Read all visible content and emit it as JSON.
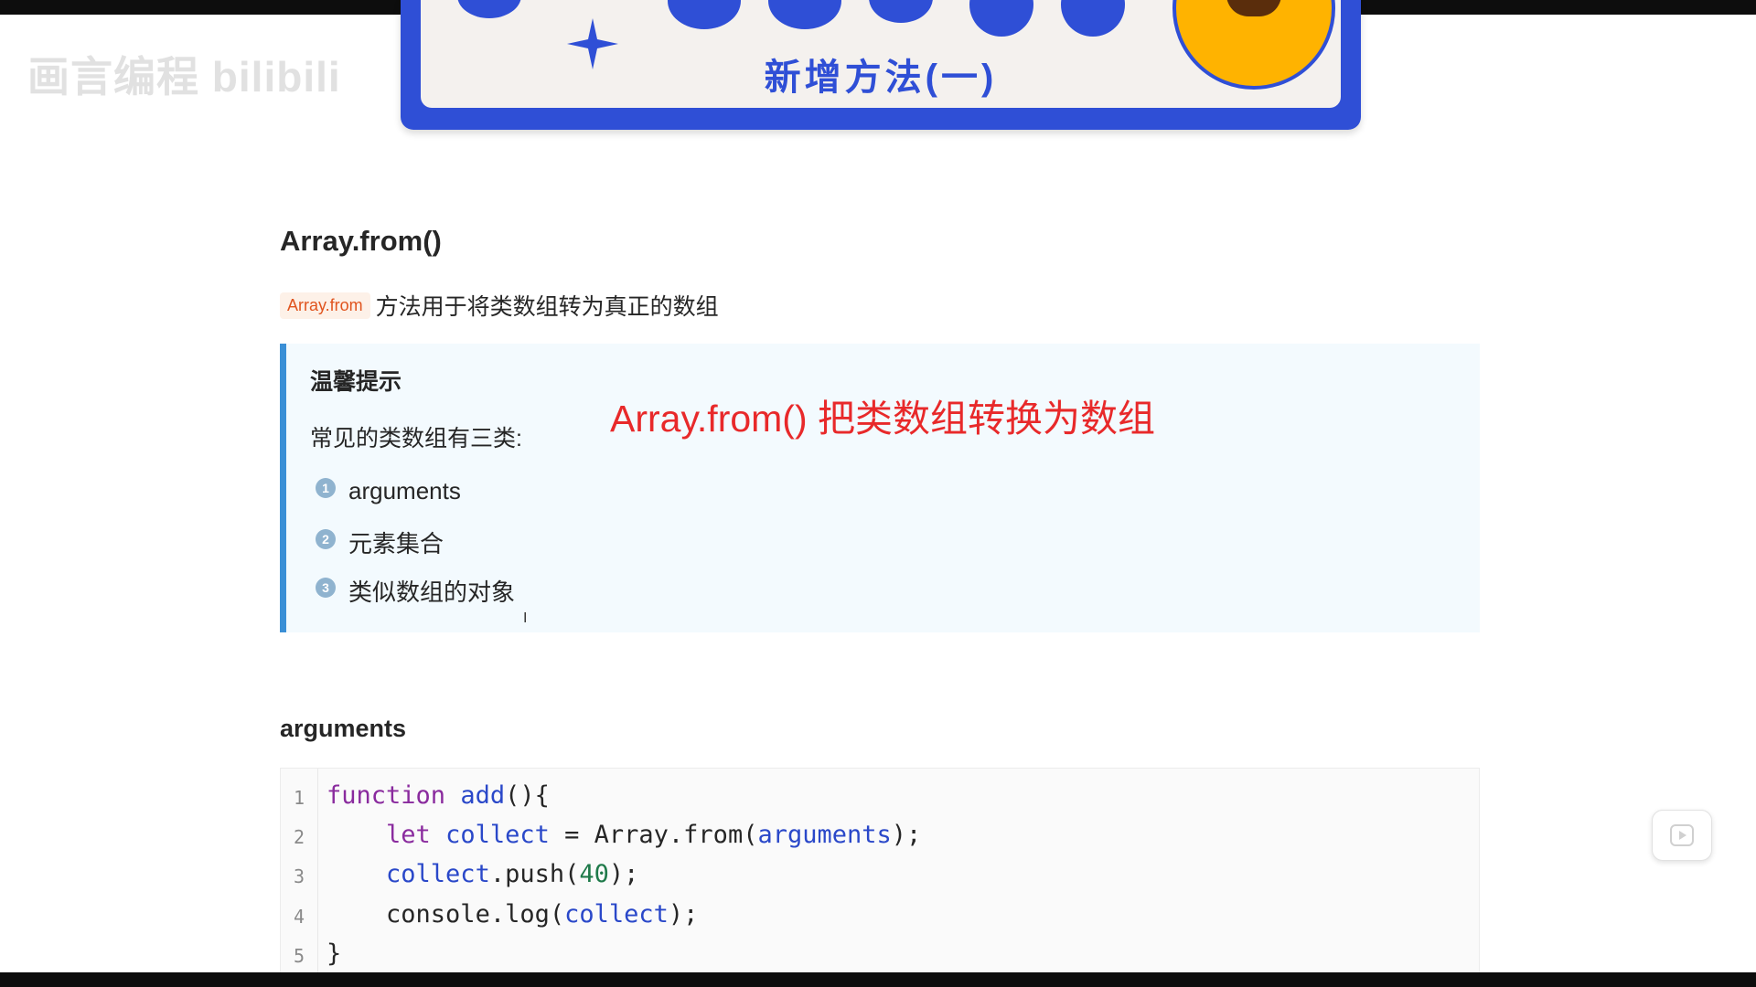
{
  "watermark": {
    "text": "画言编程 bilibili"
  },
  "banner": {
    "title": "新增方法(一)"
  },
  "section1": {
    "heading": "Array.from()",
    "intro_code": "Array.from",
    "intro_text": "方法用于将类数组转为真正的数组"
  },
  "tip": {
    "title": "温馨提示",
    "subtitle": "常见的类数组有三类:",
    "items": [
      {
        "num": "1",
        "label": "arguments"
      },
      {
        "num": "2",
        "label": "元素集合"
      },
      {
        "num": "3",
        "label": "类似数组的对象"
      }
    ]
  },
  "overlay": {
    "caption": "Array.from() 把类数组转换为数组"
  },
  "section2": {
    "heading": "arguments"
  },
  "code": {
    "line_numbers": [
      "1",
      "2",
      "3",
      "4",
      "5"
    ],
    "lines": {
      "l1": {
        "kw": "function",
        "fn": "add",
        "rest": "(){"
      },
      "l2": {
        "kw": "let",
        "var": "collect",
        "mid": " = Array.from(",
        "arg": "arguments",
        "end": ");"
      },
      "l3": {
        "var": "collect",
        "mid": ".push(",
        "num": "40",
        "end": ");"
      },
      "l4": {
        "mid": "console.log(",
        "var": "collect",
        "end": ");"
      },
      "l5": {
        "text": "}"
      }
    }
  },
  "colors": {
    "accent_blue": "#2f4fd6",
    "caption_red": "#e8292a",
    "tip_border": "#3a8fd6"
  }
}
